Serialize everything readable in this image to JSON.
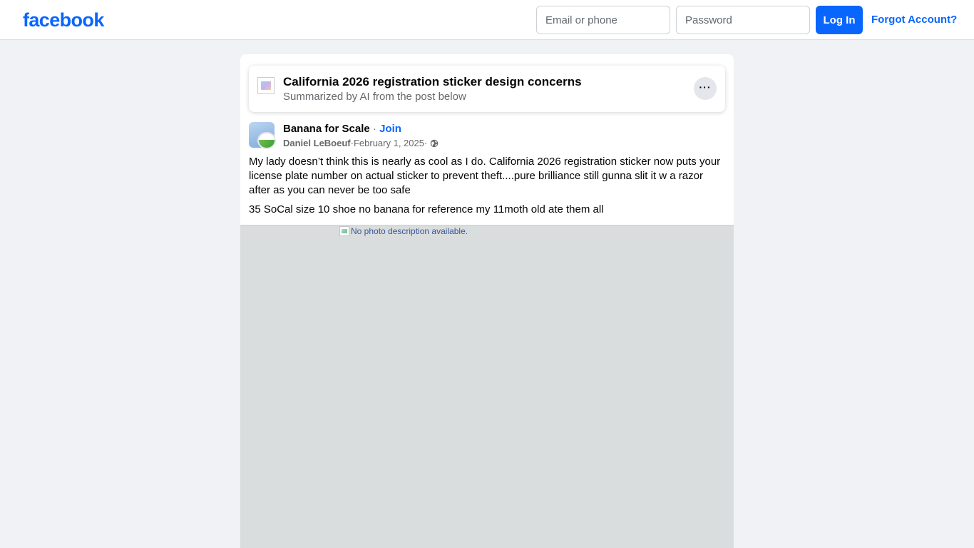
{
  "header": {
    "logo": "facebook",
    "email_placeholder": "Email or phone",
    "password_placeholder": "Password",
    "login_label": "Log In",
    "forgot_label": "Forgot Account?"
  },
  "summary": {
    "title": "California 2026 registration sticker design concerns",
    "subtitle": "Summarized by AI from the post below",
    "more_label": "···"
  },
  "post": {
    "group": "Banana for Scale",
    "separator": " · ",
    "join_label": "Join",
    "author": "Daniel LeBoeuf",
    "date": "February 1, 2025",
    "audience_icon": "globe-icon",
    "text": "My lady doesn’t think this is nearly as cool as I do. California 2026 registration sticker now puts your license plate number on actual sticker to prevent theft....pure brilliance still gunna slit it w a razor after as you can never be too safe",
    "text2": "35 SoCal size 10 shoe no banana for reference my 11moth old ate them all",
    "photo_alt": "No photo description available."
  },
  "colors": {
    "brand": "#0866ff",
    "background": "#f0f2f5",
    "secondary_text": "#65676b"
  }
}
